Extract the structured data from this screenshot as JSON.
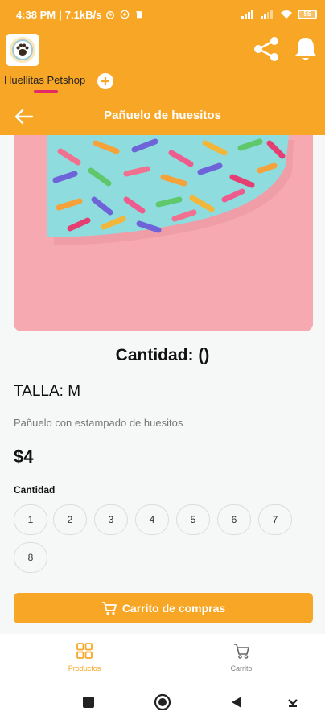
{
  "status_bar": {
    "time": "4:38 PM",
    "speed": "7.1kB/s",
    "battery": "55"
  },
  "header": {
    "store_tab": "Huellitas Petshop"
  },
  "title_bar": {
    "title": "Pañuelo de huesitos"
  },
  "product": {
    "quantity_heading": "Cantidad:  ()",
    "size": "TALLA: M",
    "description": "Pañuelo con estampado de huesitos",
    "price": "$4"
  },
  "quantity": {
    "label": "Cantidad",
    "options": [
      "1",
      "2",
      "3",
      "4",
      "5",
      "6",
      "7",
      "8"
    ]
  },
  "cart_button": {
    "label": "Carrito de compras"
  },
  "bottom_nav": {
    "items": [
      {
        "label": "Productos",
        "icon": "grid-icon",
        "active": true
      },
      {
        "label": "Carrito",
        "icon": "cart-icon",
        "active": false
      }
    ]
  },
  "colors": {
    "primary": "#f7a725",
    "accent_underline": "#e22a66",
    "background": "#f6f7f7"
  }
}
